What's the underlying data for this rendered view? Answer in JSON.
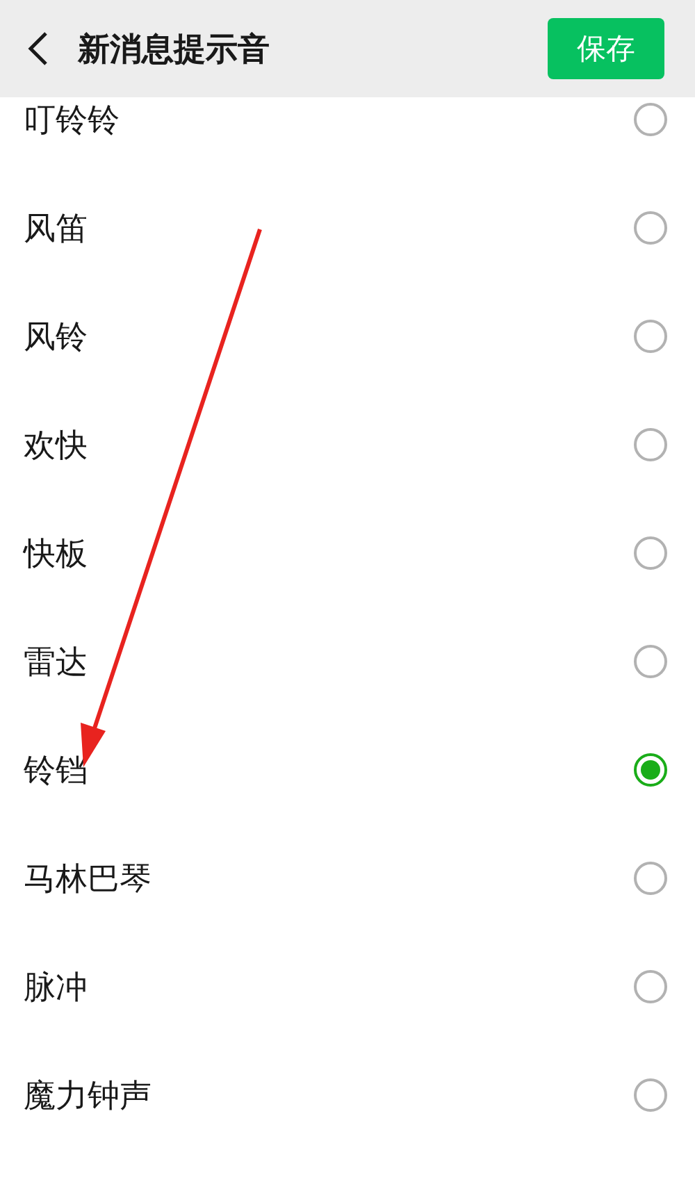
{
  "header": {
    "title": "新消息提示音",
    "save_button": "保存"
  },
  "options": [
    {
      "label": "叮铃铃",
      "selected": false
    },
    {
      "label": "风笛",
      "selected": false
    },
    {
      "label": "风铃",
      "selected": false
    },
    {
      "label": "欢快",
      "selected": false
    },
    {
      "label": "快板",
      "selected": false
    },
    {
      "label": "雷达",
      "selected": false
    },
    {
      "label": "铃铛",
      "selected": true
    },
    {
      "label": "马林巴琴",
      "selected": false
    },
    {
      "label": "脉冲",
      "selected": false
    },
    {
      "label": "魔力钟声",
      "selected": false
    }
  ]
}
